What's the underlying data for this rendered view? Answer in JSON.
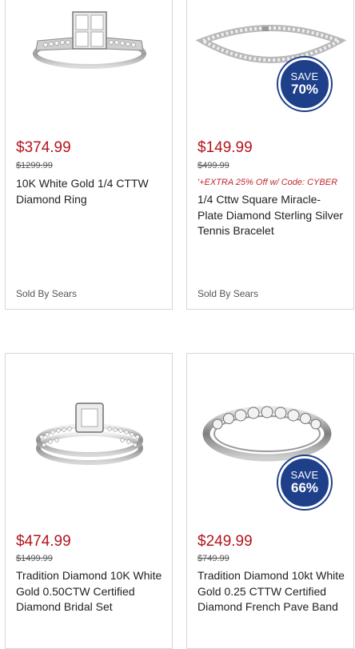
{
  "products": [
    {
      "image": "ring-princess-cluster",
      "price": "$374.99",
      "was_price": "$1299.99",
      "promo": "",
      "title": "10K White Gold 1/4 CTTW Diamond Ring",
      "seller": "Sold By Sears",
      "badge": null
    },
    {
      "image": "tennis-bracelet",
      "price": "$149.99",
      "was_price": "$499.99",
      "promo": "'+EXTRA 25% Off w/ Code: CYBER",
      "title": "1/4 Cttw Square Miracle-Plate Diamond Sterling Silver Tennis Bracelet",
      "seller": "Sold By Sears",
      "badge": {
        "label": "SAVE",
        "percent": "70%"
      }
    },
    {
      "image": "bridal-set",
      "price": "$474.99",
      "was_price": "$1499.99",
      "promo": "",
      "title": "Tradition Diamond 10K White Gold 0.50CTW Certified Diamond Bridal Set",
      "seller": "",
      "badge": null
    },
    {
      "image": "pave-band",
      "price": "$249.99",
      "was_price": "$749.99",
      "promo": "",
      "title": "Tradition Diamond 10kt White Gold 0.25 CTTW Certified Diamond French Pave Band",
      "seller": "",
      "badge": {
        "label": "SAVE",
        "percent": "66%"
      }
    }
  ],
  "colors": {
    "price": "#b4151e",
    "badge": "#1e3f8a",
    "border": "#d6d6d6"
  }
}
